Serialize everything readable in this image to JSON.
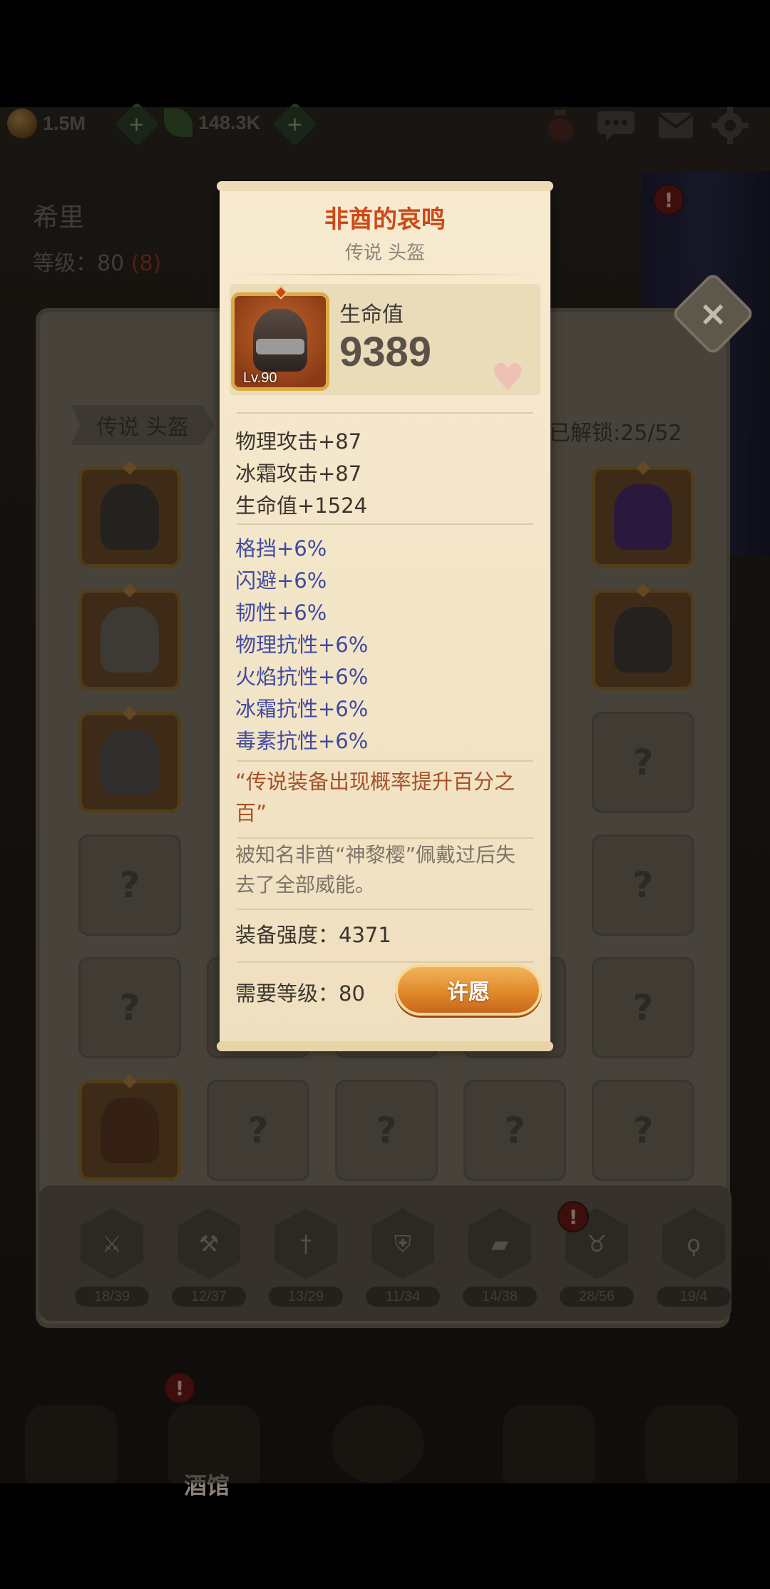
{
  "topbar": {
    "gold": "1.5M",
    "gems": "148.3K",
    "plus": "+"
  },
  "hero": {
    "name": "希里",
    "level_label": "等级：",
    "level": "80",
    "level_bonus": "(8)"
  },
  "inventory": {
    "tab_label": "传说 头盔",
    "unlock_text": "已解锁:25/52",
    "empty_mark": "?"
  },
  "categories": {
    "counts": [
      "18/39",
      "12/37",
      "13/29",
      "11/34",
      "14/38",
      "28/56",
      "19/4"
    ]
  },
  "alerts": {
    "mark": "!"
  },
  "nav": {
    "tavern_label": "酒馆"
  },
  "close": {
    "label": "×"
  },
  "item": {
    "name": "非酋的哀鸣",
    "rarity_type": "传说 头盔",
    "level_badge": "Lv.90",
    "main_stat_name": "生命值",
    "main_stat_value": "9389",
    "base_stats": [
      "物理攻击+87",
      "冰霜攻击+87",
      "生命值+1524"
    ],
    "bonus_stats": [
      "格挡+6%",
      "闪避+6%",
      "韧性+6%",
      "物理抗性+6%",
      "火焰抗性+6%",
      "冰霜抗性+6%",
      "毒素抗性+6%"
    ],
    "special_effect": "“传说装备出现概率提升百分之百”",
    "lore": "被知名非酋“神黎樱”佩戴过后失去了全部威能。",
    "power_label": "装备强度：",
    "power_value": "4371",
    "required_level_label": "需要等级：",
    "required_level_value": "80",
    "wish_button": "许愿"
  },
  "colors": {
    "title": "#cc4a18",
    "bonus_stat": "#3f4aa0",
    "special_effect": "#a5522a",
    "button": "#e08a2c"
  }
}
